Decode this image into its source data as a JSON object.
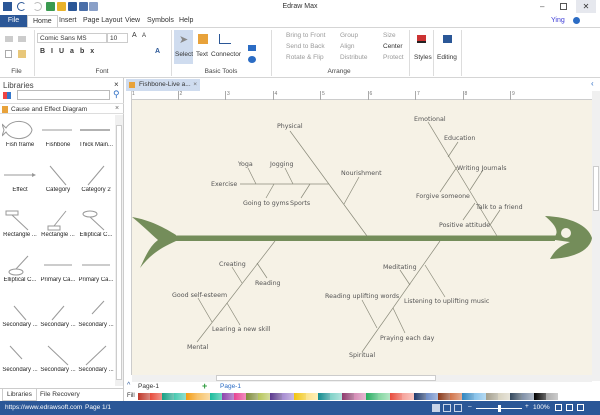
{
  "app": {
    "title": "Edraw Max",
    "user": "Ying"
  },
  "menu": {
    "tabs": [
      "File",
      "Home",
      "Insert",
      "Page Layout",
      "View",
      "Symbols",
      "Help"
    ]
  },
  "ribbon": {
    "font_name": "Comic Sans MS",
    "font_size": "10",
    "groups": {
      "file": "File",
      "font": "Font",
      "basic_tools": "Basic Tools",
      "arrange": "Arrange"
    },
    "tools": {
      "select": "Select",
      "text": "Text",
      "connector": "Connector"
    },
    "arrange": [
      "Bring to Front",
      "Send to Back",
      "Rotate & Flip",
      "Group",
      "Align",
      "Distribute",
      "Size",
      "Center",
      "Protect"
    ],
    "styles": "Styles",
    "editing": "Editing"
  },
  "libraries": {
    "title": "Libraries",
    "search_placeholder": "",
    "category": "Cause and Effect Diagram",
    "items": [
      "Fish frame",
      "Fishbone",
      "Thick Main...",
      "Effect",
      "Category",
      "Category 2",
      "Rectangle ...",
      "Rectangle ...",
      "Elliptical C...",
      "Elliptical C...",
      "Primary Ca...",
      "Primary Ca...",
      "Secondary ...",
      "Secondary ...",
      "Secondary ...",
      "Secondary ...",
      "Secondary ...",
      "Secondary ..."
    ],
    "bottom_tabs": [
      "Libraries",
      "File Recovery"
    ]
  },
  "document": {
    "tab": "Fishbone-Live a...",
    "ruler": [
      "1",
      "2",
      "3",
      "4",
      "5",
      "6",
      "7",
      "8",
      "9"
    ]
  },
  "diagram": {
    "color": "#748d5a",
    "branches": {
      "physical": "Physical",
      "emotional": "Emotional",
      "mental": "Mental",
      "spiritual": "Spiritual"
    },
    "causes": {
      "exercise": "Exercise",
      "yoga": "Yoga",
      "jogging": "Jogging",
      "gyms": "Going to gyms",
      "sports": "Sports",
      "nourishment": "Nourishment",
      "education": "Education",
      "journals": "Writing Journals",
      "forgive": "Forgive someone",
      "talk": "Talk to a friend",
      "positive": "Positive attitude",
      "creating": "Creating",
      "reading": "Reading",
      "esteem": "Good self-esteem",
      "learning": "Learing a new skill",
      "meditating": "Meditating",
      "music": "Listening to uplifting music",
      "words": "Reading uplifting words",
      "praying": "Praying each day"
    }
  },
  "pages": {
    "selector": "Page-1",
    "active": "Page-1",
    "fill": "Fill"
  },
  "palette": [
    "#c0392b",
    "#e74c3c",
    "#16a085",
    "#48c9b0",
    "#f39c12",
    "#f7c46c",
    "#1abc9c",
    "#8e44ad",
    "#e84393",
    "#7f8c3a",
    "#b5c45a",
    "#5b3a8e",
    "#a58bd0",
    "#f1c40f",
    "#fbe38c",
    "#138d90",
    "#7fd1c7",
    "#8e3a6d",
    "#d58bb5",
    "#27ae60",
    "#82d59e",
    "#e84c3d",
    "#f5a29a",
    "#1f3a6d",
    "#6d8cc7",
    "#8b3a1a",
    "#d1744a",
    "#2e86c1",
    "#85c1e9",
    "#a39e8c",
    "#d7d2c0",
    "#34495e",
    "#7f8fa6",
    "#000000",
    "#aaaaaa",
    "#ffffff"
  ],
  "status": {
    "url": "https://www.edrawsoft.com",
    "page": "Page 1/1",
    "zoom": "100%",
    "zoom_level": 0.5
  }
}
